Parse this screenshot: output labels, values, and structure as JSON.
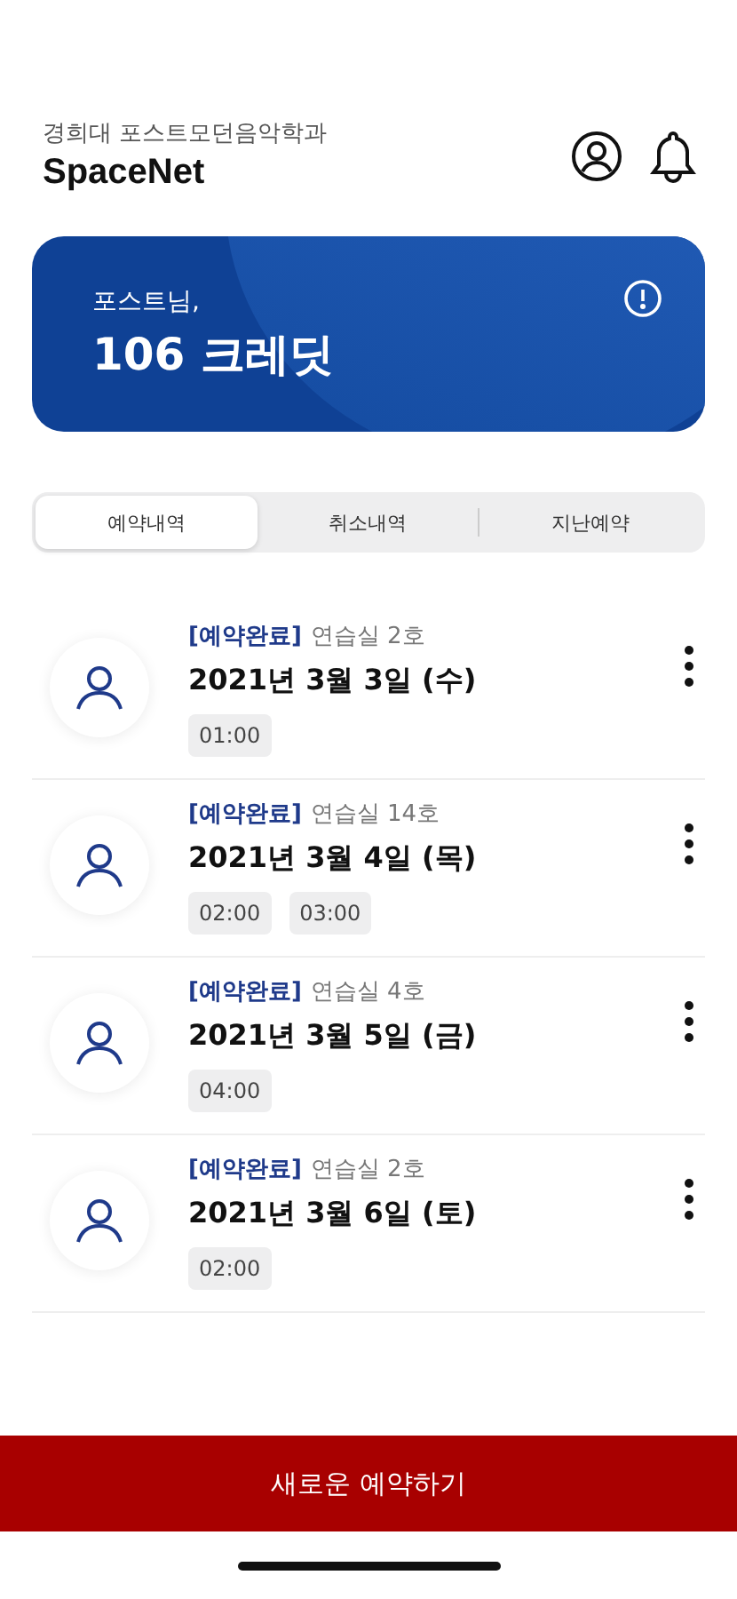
{
  "header": {
    "subtitle": "경희대 포스트모던음악학과",
    "title": "SpaceNet"
  },
  "credit_card": {
    "greeting": "포스트님,",
    "credits": "106 크레딧"
  },
  "tabs": [
    {
      "label": "예약내역",
      "selected": true
    },
    {
      "label": "취소내역",
      "selected": false
    },
    {
      "label": "지난예약",
      "selected": false
    }
  ],
  "reservations": [
    {
      "status": "[예약완료]",
      "room": "연습실 2호",
      "date": "2021년 3월 3일 (수)",
      "times": [
        "01:00"
      ]
    },
    {
      "status": "[예약완료]",
      "room": "연습실 14호",
      "date": "2021년 3월 4일 (목)",
      "times": [
        "02:00",
        "03:00"
      ]
    },
    {
      "status": "[예약완료]",
      "room": "연습실 4호",
      "date": "2021년 3월 5일 (금)",
      "times": [
        "04:00"
      ]
    },
    {
      "status": "[예약완료]",
      "room": "연습실 2호",
      "date": "2021년 3월 6일 (토)",
      "times": [
        "02:00"
      ]
    }
  ],
  "new_reservation_button": "새로운 예약하기"
}
